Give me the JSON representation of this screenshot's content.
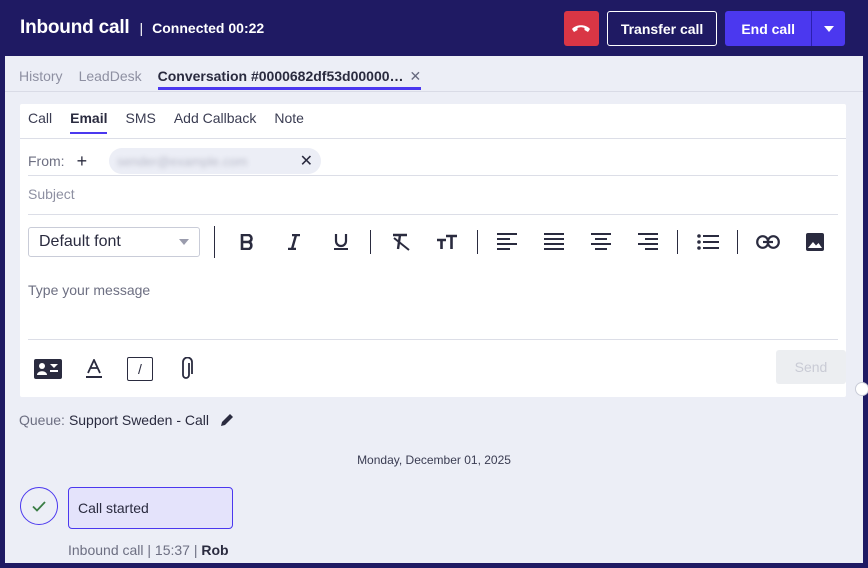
{
  "header": {
    "title": "Inbound call",
    "separator": "|",
    "status": "Connected 00:22",
    "transfer_label": "Transfer call",
    "end_label": "End call"
  },
  "tabs": [
    {
      "label": "History"
    },
    {
      "label": "LeadDesk"
    },
    {
      "label": "Conversation #0000682df53d00000…"
    }
  ],
  "composer": {
    "tabs": [
      "Call",
      "Email",
      "SMS",
      "Add Callback",
      "Note"
    ],
    "active_tab": "Email",
    "from_label": "From:",
    "from_email": "sender@example.com",
    "subject_placeholder": "Subject",
    "font_select": "Default font",
    "message_placeholder": "Type your message",
    "send_label": "Send"
  },
  "queue": {
    "label": "Queue:",
    "value": "Support Sweden - Call"
  },
  "timeline": {
    "date": "Monday, December 01, 2025",
    "event_label": "Call started",
    "meta": "Inbound call | 15:37 |",
    "agent": "Rob"
  },
  "colors": {
    "accent": "#4b38ef",
    "header_bg": "#1f1a63",
    "hangup": "#d93645",
    "panel_bg": "#eceef6"
  }
}
